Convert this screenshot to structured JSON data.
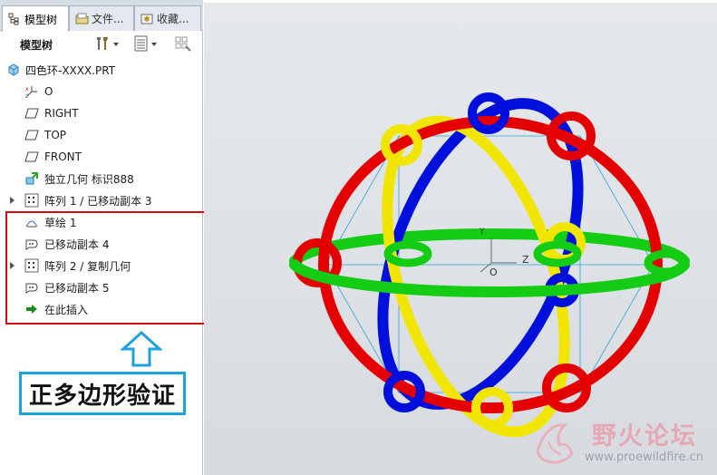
{
  "tabs": [
    {
      "label": "模型树",
      "icon": "model-tree-icon",
      "active": true
    },
    {
      "label": "文件...",
      "icon": "folder-icon",
      "active": false
    },
    {
      "label": "收藏...",
      "icon": "favorites-icon",
      "active": false
    }
  ],
  "toolbar": {
    "label": "模型树",
    "buttons": [
      {
        "icon": "settings-tools-icon"
      },
      {
        "icon": "show-list-icon"
      },
      {
        "icon": "tree-filter-icon"
      }
    ]
  },
  "tree": {
    "root": {
      "label": "四色环-XXXX.PRT",
      "icon": "part-icon"
    },
    "items": [
      {
        "label": "O",
        "icon": "csys-icon",
        "expandable": false
      },
      {
        "label": "RIGHT",
        "icon": "datum-plane-icon",
        "expandable": false
      },
      {
        "label": "TOP",
        "icon": "datum-plane-icon",
        "expandable": false
      },
      {
        "label": "FRONT",
        "icon": "datum-plane-icon",
        "expandable": false
      },
      {
        "label": "独立几何 标识888",
        "icon": "independent-geometry-icon",
        "expandable": false
      },
      {
        "label": "阵列 1 / 已移动副本 3",
        "icon": "pattern-icon",
        "expandable": true
      },
      {
        "label": "草绘 1",
        "icon": "sketch-icon",
        "expandable": false
      },
      {
        "label": "已移动副本 4",
        "icon": "moved-copy-icon",
        "expandable": false
      },
      {
        "label": "阵列 2 / 复制几何",
        "icon": "pattern-icon",
        "expandable": true
      },
      {
        "label": "已移动副本 5",
        "icon": "moved-copy-icon",
        "expandable": false
      },
      {
        "label": "在此插入",
        "icon": "insert-here-arrow-icon",
        "expandable": false
      }
    ]
  },
  "annotation": {
    "text": "正多边形验证"
  },
  "viewport": {
    "csys_labels": {
      "y": "Y",
      "z": "Z",
      "origin": "O"
    },
    "ring_colors": {
      "red": "#e40000",
      "yellow": "#f2e600",
      "blue": "#0010dc",
      "green": "#14cc14"
    }
  },
  "watermark": {
    "title": "野火论坛",
    "url": "www.proewildfire.cn"
  },
  "colors": {
    "highlight": "#cc0f0f",
    "annotation_border": "#1fa2dc",
    "arrow": "#1fa2dc"
  }
}
